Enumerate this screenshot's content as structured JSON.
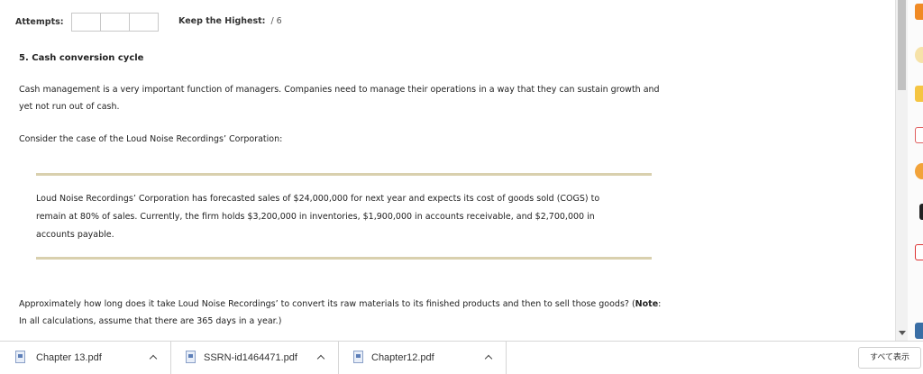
{
  "header": {
    "attempts_label": "Attempts:",
    "attempt_slots": 3,
    "keep_label": "Keep the Highest:",
    "keep_value": "/ 6"
  },
  "question": {
    "title": "5. Cash conversion cycle",
    "intro_line1": "Cash management is a very important function of managers. Companies need to manage their operations in a way that they can sustain growth and",
    "intro_line2": "yet not run out of cash.",
    "consider": "Consider the case of the Loud Noise Recordings’ Corporation:",
    "case_line1": "Loud Noise Recordings’ Corporation has forecasted sales of $24,000,000 for next year and expects its cost of goods sold (COGS) to",
    "case_line2": "remain at 80% of sales. Currently, the firm holds $3,200,000 in inventories, $1,900,000 in accounts receivable, and $2,700,000 in",
    "case_line3": "accounts payable.",
    "prompt_line1_pre": "Approximately how long does it take Loud Noise Recordings’ to convert its raw materials to its finished products and then to sell those goods? (",
    "prompt_note": "Note",
    "prompt_line1_post": ":",
    "prompt_line2": "In all calculations, assume that there are 365 days in a year.)"
  },
  "downloads": {
    "items": [
      {
        "name": "Chapter 13.pdf",
        "icon": "pdf-file-icon"
      },
      {
        "name": "SSRN-id1464471.pdf",
        "icon": "pdf-file-icon"
      },
      {
        "name": "Chapter12.pdf",
        "icon": "pdf-file-icon"
      }
    ],
    "show_all": "すべて表示"
  },
  "colors": {
    "rule": "#d9d0ae",
    "scroll_thumb": "#c1c1c1"
  }
}
